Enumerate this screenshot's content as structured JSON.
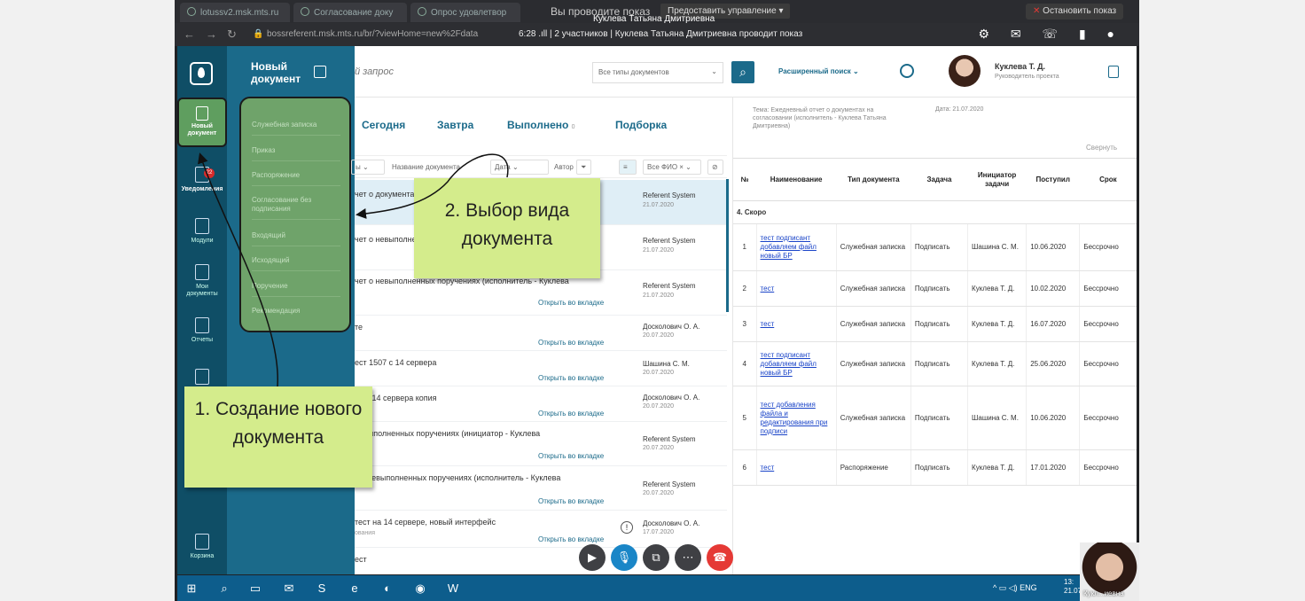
{
  "browser": {
    "tabs": [
      "lotussv2.msk.mts.ru",
      "Согласование доку",
      "Опрос удовлетвор"
    ],
    "sharing_label": "Вы проводите показ",
    "control_label": "Предоставить управление",
    "presenter": "Куклева Татьяна Дмитриевна",
    "stop_label": "Остановить показ",
    "url": "bossreferent.msk.mts.ru/br/?viewHome=new%2Fdata",
    "call_info": "6:28  .ıll  |  2 участников  |  Куклева Татьяна Дмитриевна проводит показ"
  },
  "rail": {
    "new_doc": "Новый документ",
    "notifications": "Уведомления",
    "notifications_count": "22",
    "modules": "Модули",
    "my_docs": "Мои документы",
    "reports": "Отчеты",
    "trash": "Корзина"
  },
  "new_doc_panel": {
    "title": "Новый документ",
    "types": [
      "Служебная записка",
      "Приказ",
      "Распоряжение",
      "Согласование без подписания",
      "Входящий",
      "Исходящий",
      "Поручение",
      "Рекомендация"
    ]
  },
  "search": {
    "placeholder": "й запрос",
    "doc_type": "Все типы документов",
    "advanced": "Расширенный поиск"
  },
  "user": {
    "name": "Куклева Т. Д.",
    "role": "Руководитель проекта"
  },
  "list": {
    "tabs": [
      "Сегодня",
      "Завтра",
      "Выполнено",
      "Подборка"
    ],
    "done_count": "0",
    "filters": {
      "types": "ы",
      "doc_name": "Название документа",
      "date": "Дата",
      "author": "Автор",
      "fio": "Все ФИО"
    },
    "open_tab": "Открыть во вкладке",
    "rows": [
      {
        "title": "чет о документах",
        "author": "Referent System",
        "date": "21.07.2020"
      },
      {
        "title": "чет о невыполне",
        "author": "Referent System",
        "date": "21.07.2020"
      },
      {
        "title": "чет о невыполненных поручениях (исполнитель - Куклева",
        "author": "Referent System",
        "date": "21.07.2020"
      },
      {
        "title": "те",
        "author": "Досколович О. А.",
        "date": "20.07.2020"
      },
      {
        "title": "ест 1507 с 14 сервера",
        "author": "Шашина С. М.",
        "date": "20.07.2020"
      },
      {
        "title": "07 с 14 сервера копия",
        "author": "Досколович О. А.",
        "date": "20.07.2020"
      },
      {
        "title": "невыполненных поручениях (инициатор - Куклева",
        "author": "Referent System",
        "date": "20.07.2020"
      },
      {
        "title": "т о невыполненных поручениях (исполнитель - Куклева",
        "author": "Referent System",
        "date": "20.07.2020"
      },
      {
        "title": "тест на 14 сервере, новый интерфейс",
        "sub": "ования",
        "author": "Досколович О. А.",
        "date": "17.07.2020"
      },
      {
        "title": "ест",
        "author": "",
        "date": ""
      }
    ]
  },
  "detail": {
    "subject": "Тема: Ежедневный отчет о документах на согласовании (исполнитель - Куклева Татьяна Дмитриевна)",
    "date": "Дата: 21.07.2020",
    "collapse": "Свернуть",
    "headers": [
      "№",
      "Наименование",
      "Тип документа",
      "Задача",
      "Инициатор задачи",
      "Поступил",
      "Срок"
    ],
    "group": "4. Скоро",
    "rows": [
      [
        "1",
        "тест подписант добавляем файл новый БР",
        "Служебная записка",
        "Подписать",
        "Шашина С. М.",
        "10.06.2020",
        "Бессрочно"
      ],
      [
        "2",
        "тест",
        "Служебная записка",
        "Подписать",
        "Куклева Т. Д.",
        "10.02.2020",
        "Бессрочно"
      ],
      [
        "3",
        "тест",
        "Служебная записка",
        "Подписать",
        "Куклева Т. Д.",
        "16.07.2020",
        "Бессрочно"
      ],
      [
        "4",
        "тест подписант добавляем файл новый БР",
        "Служебная записка",
        "Подписать",
        "Куклева Т. Д.",
        "25.06.2020",
        "Бессрочно"
      ],
      [
        "5",
        "тест добавления файла и редактирования при подписи",
        "Служебная записка",
        "Подписать",
        "Шашина С. М.",
        "10.06.2020",
        "Бессрочно"
      ],
      [
        "6",
        "тест",
        "Распоряжение",
        "Подписать",
        "Куклева Т. Д.",
        "17.01.2020",
        "Бессрочно"
      ]
    ]
  },
  "callouts": {
    "step1": "1. Создание нового документа",
    "step2": "2. Выбор вида документа"
  },
  "taskbar": {
    "lang": "ENG",
    "time": "13:",
    "date": "21.07"
  },
  "self_view_name": "Кукл...иевна",
  "colors": {
    "brand": "#1b6a8a",
    "rail": "#0f4e66",
    "highlight_green": "#6fa36a",
    "callout": "#d4ec8c",
    "hangup": "#e53935"
  }
}
